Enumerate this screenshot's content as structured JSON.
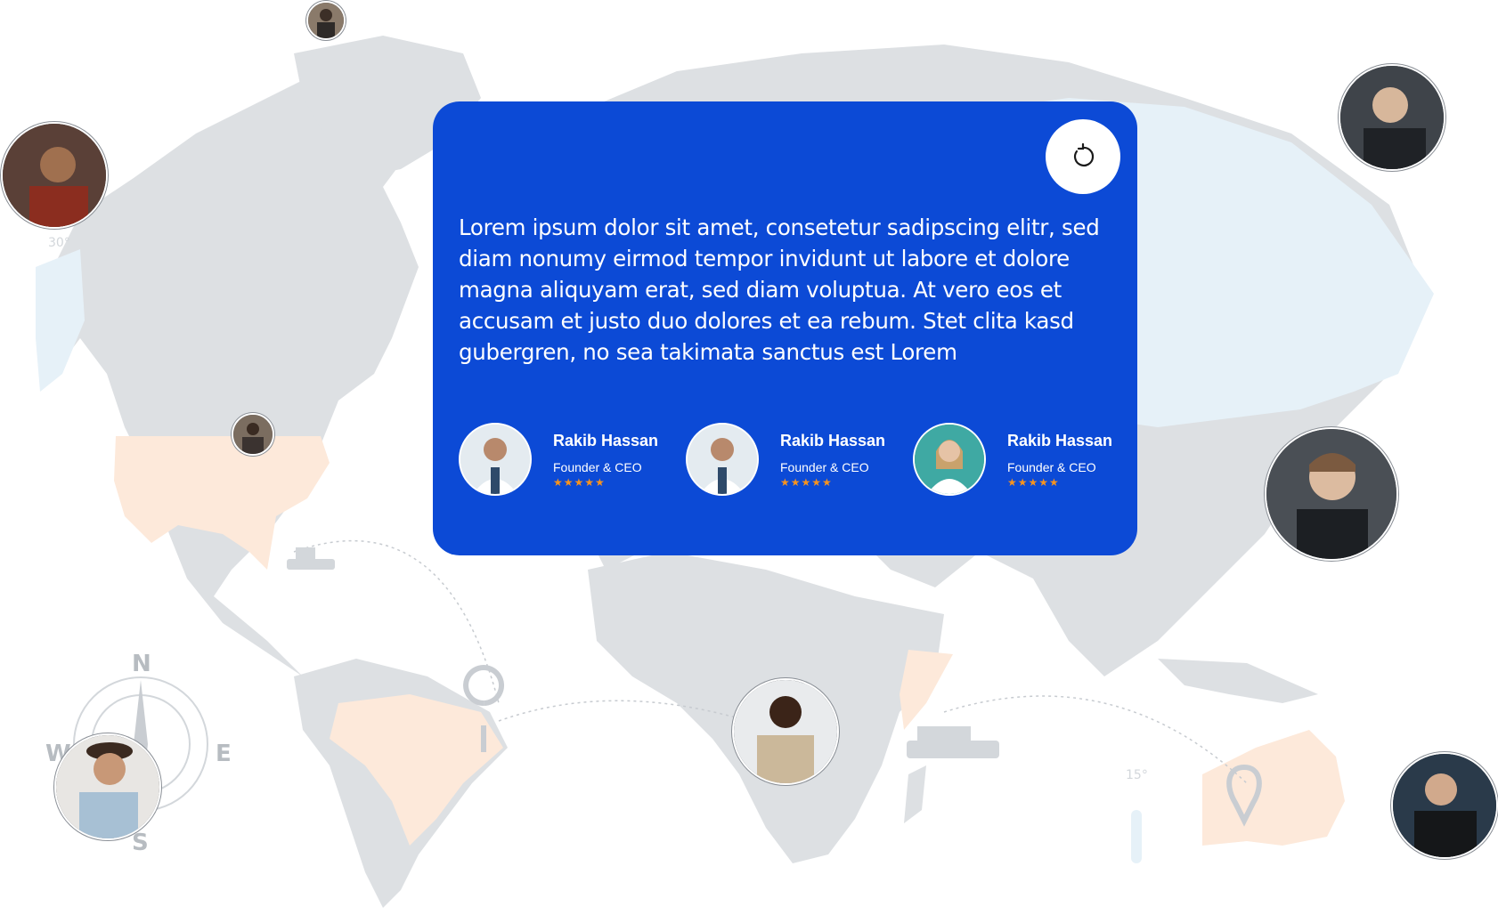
{
  "testimonial": {
    "quote": "Lorem ipsum dolor sit amet, consetetur sadipscing elitr, sed diam nonumy eirmod tempor invidunt ut labore et dolore magna aliquyam erat, sed diam voluptua. At vero eos et accusam et justo duo dolores et ea rebum. Stet clita kasd gubergren, no sea takimata sanctus est Lorem",
    "refresh_icon": "refresh-icon",
    "reviewers": [
      {
        "name": "Rakib Hassan",
        "role": "Founder & CEO",
        "stars": "★★★★★",
        "rating": 5
      },
      {
        "name": "Rakib Hassan",
        "role": "Founder & CEO",
        "stars": "★★★★★",
        "rating": 5
      },
      {
        "name": "Rakib Hassan",
        "role": "Founder & CEO",
        "stars": "★★★★★",
        "rating": 5
      }
    ]
  },
  "map": {
    "labels": {
      "lat30": "30°",
      "lat15": "15°"
    },
    "compass": {
      "n": "N",
      "s": "S",
      "e": "E",
      "w": "W"
    }
  },
  "colors": {
    "card": "#0c4ad6",
    "land": "#dde0e3",
    "highlight": "#fde9da",
    "ice": "#e6f1f8",
    "star": "#f7931e"
  }
}
